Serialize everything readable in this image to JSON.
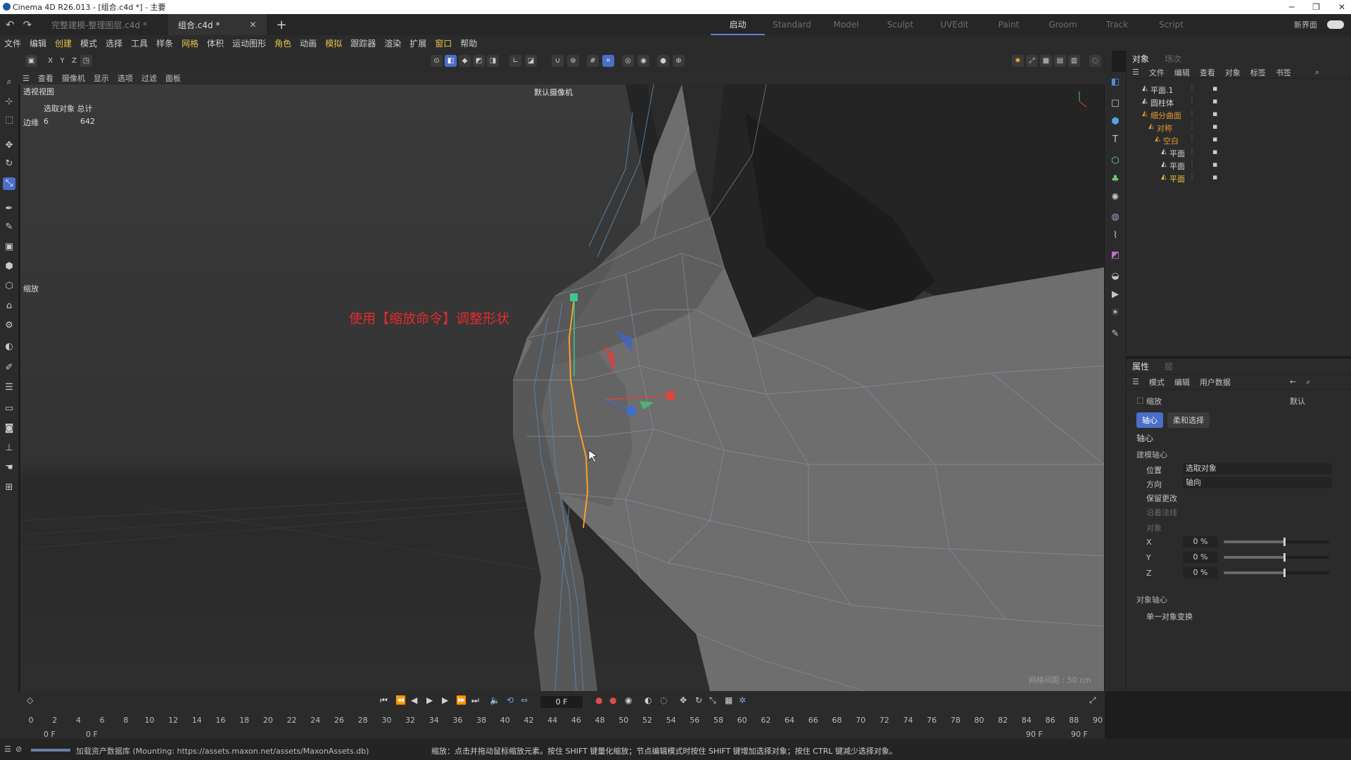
{
  "window": {
    "title": "Cinema 4D R26.013 - [组合.c4d *] - 主要"
  },
  "tabs": [
    {
      "label": "完整建模-整理图层.c4d *"
    },
    {
      "label": "组合.c4d *"
    }
  ],
  "layouts": [
    "启动",
    "Standard",
    "Model",
    "Sculpt",
    "UVEdit",
    "Paint",
    "Groom",
    "Track",
    "Script"
  ],
  "new_interface_label": "新界面",
  "menu": [
    "文件",
    "编辑",
    "创建",
    "模式",
    "选择",
    "工具",
    "样条",
    "网格",
    "体积",
    "运动图形",
    "角色",
    "动画",
    "模拟",
    "跟踪器",
    "渲染",
    "扩展",
    "窗口",
    "帮助"
  ],
  "toolbar_axes": [
    "X",
    "Y",
    "Z"
  ],
  "viewport": {
    "menu": [
      "查看",
      "摄像机",
      "显示",
      "选项",
      "过滤",
      "面板"
    ],
    "name": "透视视图",
    "camera": "默认摄像机",
    "stats_header": "选取对象 总计",
    "stats_label": "边缘",
    "stats_selected": "6",
    "stats_total": "642",
    "tool_label": "缩放",
    "annotation": "使用【缩放命令】调整形状",
    "grid_spacing": "网格间距 : 50 cm"
  },
  "object_manager": {
    "tabs": [
      "对象",
      "场次"
    ],
    "menu": [
      "文件",
      "编辑",
      "查看",
      "对象",
      "标签",
      "书签"
    ],
    "objects": [
      {
        "name": "平面.1",
        "indent": 0,
        "color": "#d3d3d3",
        "icon": "polygon-icon"
      },
      {
        "name": "圆柱体",
        "indent": 0,
        "color": "#d3d3d3",
        "icon": "cylinder-icon"
      },
      {
        "name": "细分曲面",
        "indent": 0,
        "color": "#e39a30",
        "icon": "subdivision-icon"
      },
      {
        "name": "对称",
        "indent": 1,
        "color": "#e39a30",
        "icon": "symmetry-icon"
      },
      {
        "name": "空白",
        "indent": 2,
        "color": "#e39a30",
        "icon": "null-icon"
      },
      {
        "name": "平面",
        "indent": 3,
        "color": "#d3d3d3",
        "icon": "polygon-icon"
      },
      {
        "name": "平面",
        "indent": 3,
        "color": "#d3d3d3",
        "icon": "polygon-icon"
      },
      {
        "name": "平面",
        "indent": 3,
        "color": "#e8c33a",
        "icon": "polygon-icon"
      }
    ]
  },
  "attributes": {
    "tabs": [
      "属性",
      "层"
    ],
    "menu": [
      "模式",
      "编辑",
      "用户数据"
    ],
    "tool_name": "缩放",
    "preset": "默认",
    "subtabs": [
      "轴心",
      "柔和选择"
    ],
    "section": "轴心",
    "group_modeling_axis": "建模轴心",
    "position_label": "位置",
    "position_value": "选取对象",
    "orientation_label": "方向",
    "orientation_value": "轴向",
    "retain_changes": "保留更改",
    "along_normals": "沿着法线",
    "object_label": "对象",
    "x_label": "X",
    "x_value": "0 %",
    "y_label": "Y",
    "y_value": "0 %",
    "z_label": "Z",
    "z_value": "0 %",
    "group_object_axis": "对象轴心",
    "single_object": "单一对象变换"
  },
  "timeline": {
    "current_frame": "0 F",
    "start": "0 F",
    "start2": "0 F",
    "end": "90 F",
    "end2": "90 F",
    "ticks": [
      "0",
      "2",
      "4",
      "6",
      "8",
      "10",
      "12",
      "14",
      "16",
      "18",
      "20",
      "22",
      "24",
      "26",
      "28",
      "30",
      "32",
      "34",
      "36",
      "38",
      "40",
      "42",
      "44",
      "46",
      "48",
      "50",
      "52",
      "54",
      "56",
      "58",
      "60",
      "62",
      "64",
      "66",
      "68",
      "70",
      "72",
      "74",
      "76",
      "78",
      "80",
      "82",
      "84",
      "86",
      "88",
      "90"
    ]
  },
  "status": {
    "left": "加载资产数据库 (Mounting: https://assets.maxon.net/assets/MaxonAssets.db)",
    "message": "缩放：点击并拖动鼠标缩放元素。按住 SHIFT 键量化缩放；节点编辑模式时按住 SHIFT 键增加选择对象；按住 CTRL 键减少选择对象。"
  }
}
